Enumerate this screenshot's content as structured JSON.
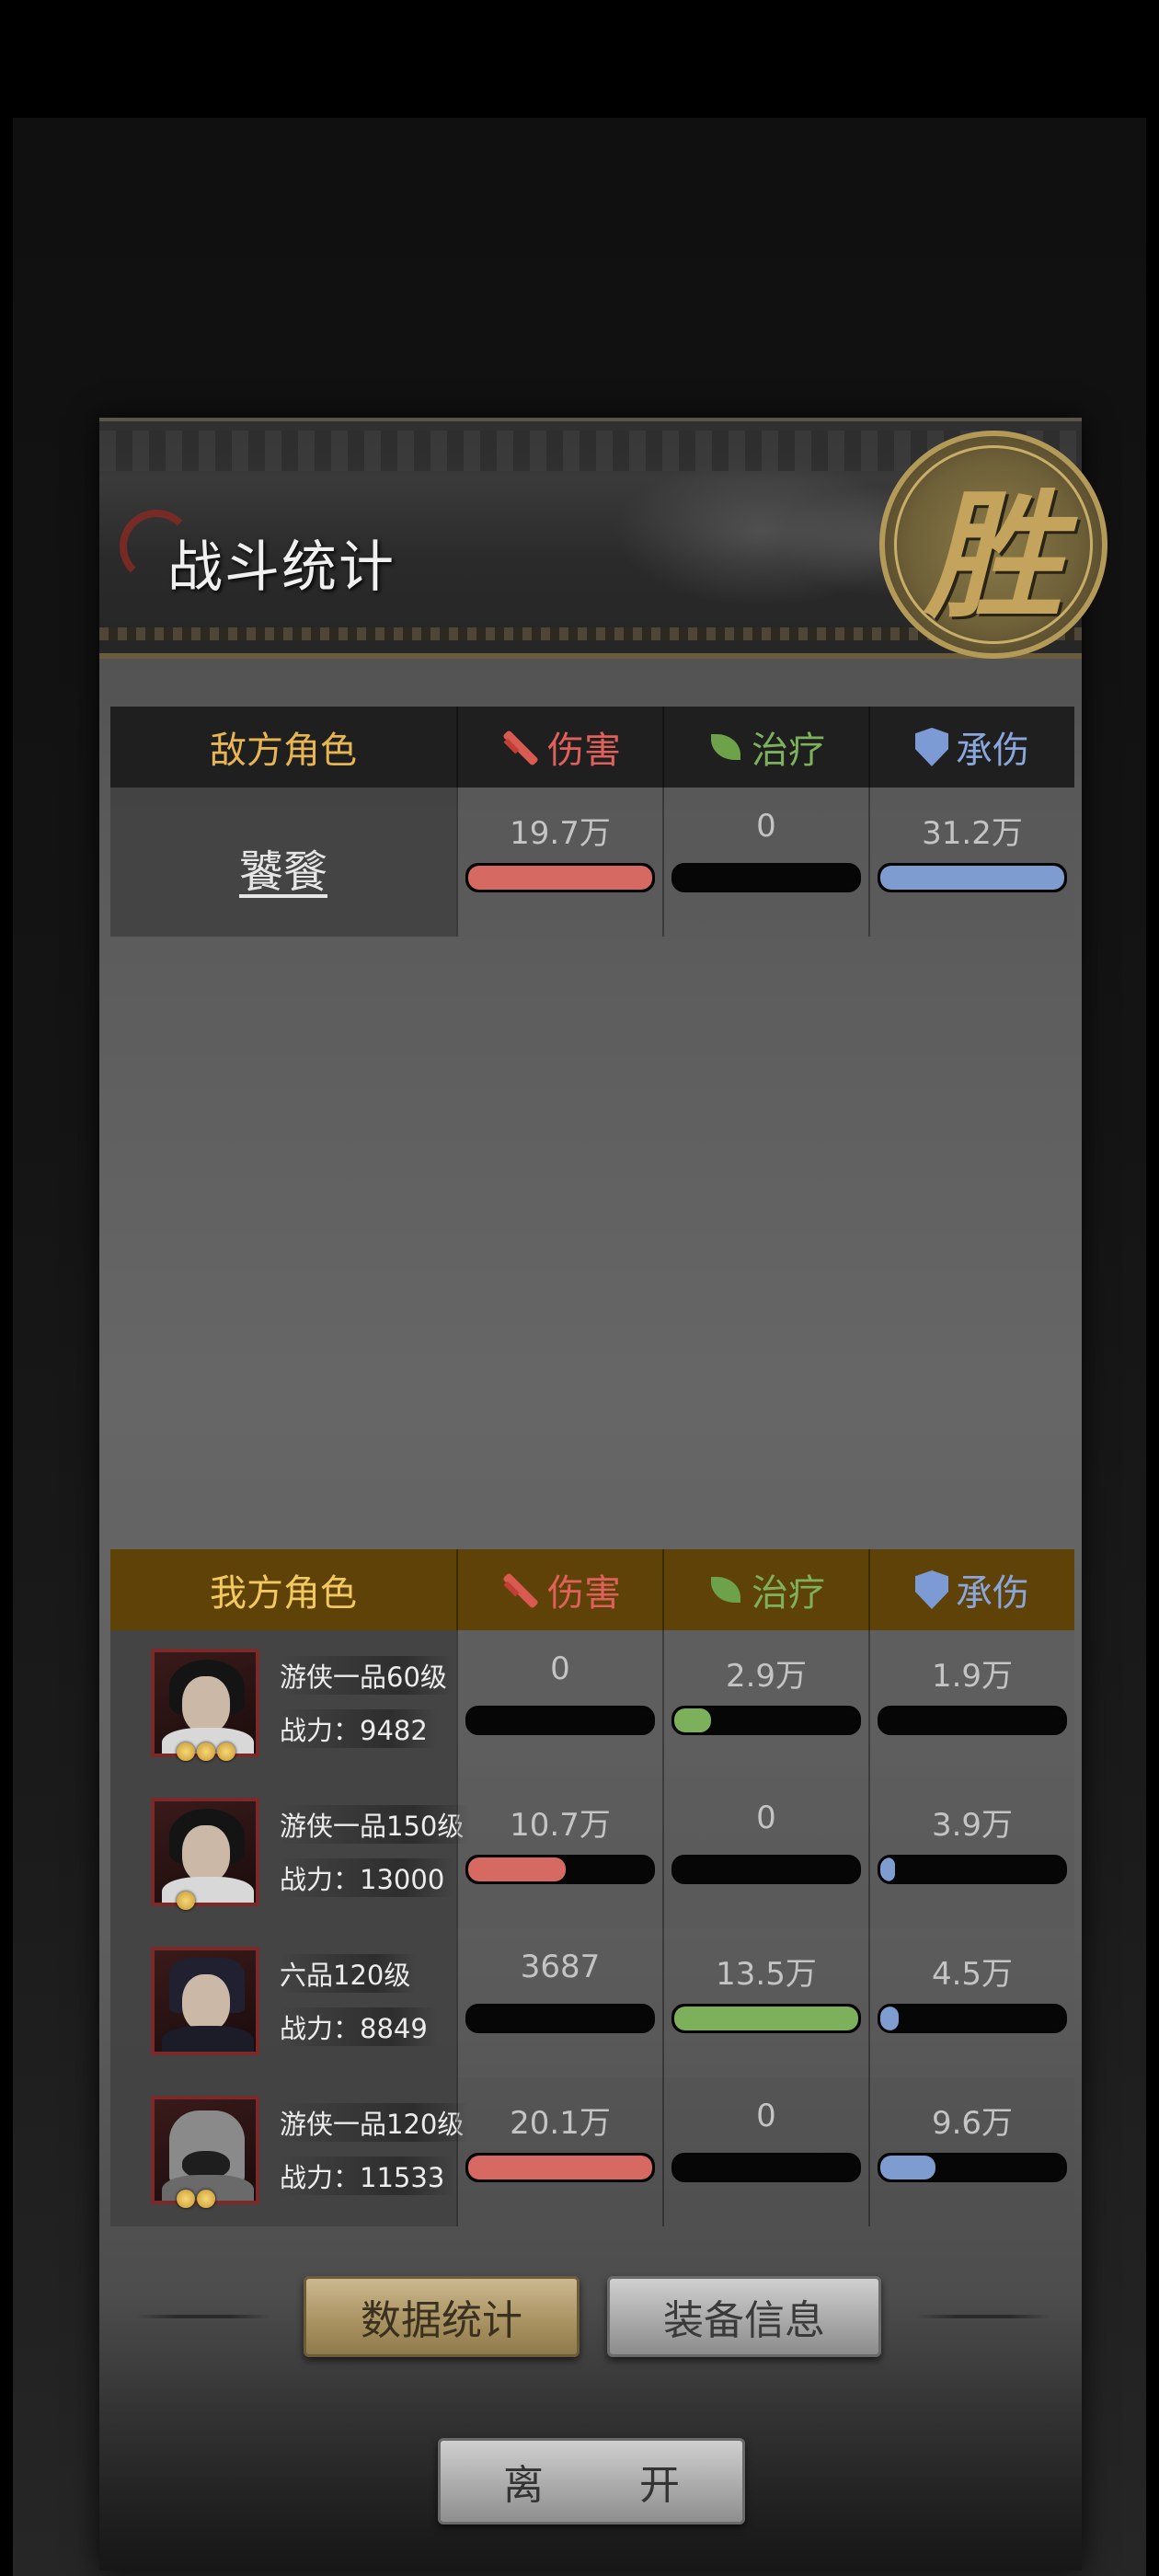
{
  "header": {
    "title": "战斗统计",
    "result_seal": "胜"
  },
  "columns": {
    "damage": "伤害",
    "heal": "治疗",
    "taken": "承伤"
  },
  "enemy": {
    "heading": "敌方角色",
    "rows": [
      {
        "name": "饕餮",
        "damage": "19.7万",
        "heal": "0",
        "taken": "31.2万",
        "damage_ratio": 1.0,
        "heal_ratio": 0.0,
        "taken_ratio": 1.0
      }
    ]
  },
  "ally": {
    "heading": "我方角色",
    "power_label": "战力：",
    "rows": [
      {
        "name": "游侠一品60级",
        "power": "9482",
        "stars": 3,
        "damage": "0",
        "heal": "2.9万",
        "taken": "1.9万",
        "damage_ratio": 0.0,
        "heal_ratio": 0.2,
        "taken_ratio": 0.0
      },
      {
        "name": "游侠一品150级",
        "power": "13000",
        "stars": 1,
        "damage": "10.7万",
        "heal": "0",
        "taken": "3.9万",
        "damage_ratio": 0.53,
        "heal_ratio": 0.0,
        "taken_ratio": 0.08
      },
      {
        "name": "六品120级",
        "power": "8849",
        "stars": 0,
        "damage": "3687",
        "heal": "13.5万",
        "taken": "4.5万",
        "damage_ratio": 0.0,
        "heal_ratio": 1.0,
        "taken_ratio": 0.1
      },
      {
        "name": "游侠一品120级",
        "power": "11533",
        "stars": 2,
        "damage": "20.1万",
        "heal": "0",
        "taken": "9.6万",
        "damage_ratio": 1.0,
        "heal_ratio": 0.0,
        "taken_ratio": 0.3
      }
    ]
  },
  "buttons": {
    "stats": "数据统计",
    "equipment": "装备信息",
    "leave": "离　开"
  },
  "colors": {
    "damage": "#d66a62",
    "heal": "#7cb05a",
    "taken": "#7e9cd0",
    "enemy_header": "#1f1f1f",
    "ally_header": "#5e4208"
  }
}
